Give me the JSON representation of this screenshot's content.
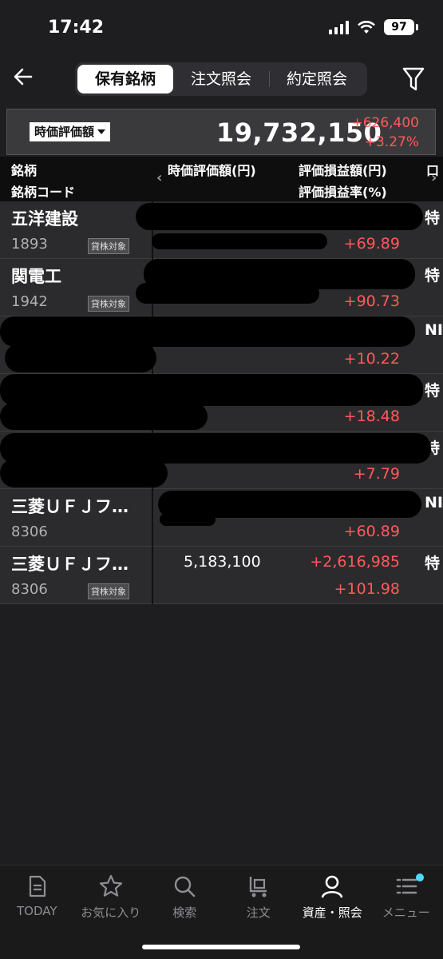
{
  "status": {
    "time": "17:42",
    "battery": "97"
  },
  "header": {
    "tabs": [
      {
        "label": "保有銘柄"
      },
      {
        "label": "注文照会"
      },
      {
        "label": "約定照会"
      }
    ]
  },
  "summary": {
    "dropdown": "時価評価額",
    "total": "19,732,150",
    "change": "+626,400",
    "change_pct": "+3.27%"
  },
  "table_header": {
    "col1a": "銘柄",
    "col1b": "銘柄コード",
    "col2": "時価評価額(円)",
    "col3a": "評価損益額(円)",
    "col3b": "評価損益率(%)",
    "col4": "口"
  },
  "holdings": [
    {
      "name": "五洋建設",
      "code": "1893",
      "tag": "貸株対象",
      "value": "",
      "pl": "",
      "rate": "+69.89",
      "account": "特"
    },
    {
      "name": "関電工",
      "code": "1942",
      "tag": "貸株対象",
      "value": "",
      "pl": "",
      "rate": "+90.73",
      "account": "特"
    },
    {
      "name": "",
      "code": "",
      "tag": "",
      "value": "",
      "pl": "",
      "rate": "+10.22",
      "account": "NI"
    },
    {
      "name": "",
      "code": "",
      "tag": "",
      "value": "",
      "pl": "",
      "rate": "+18.48",
      "account": "特"
    },
    {
      "name": "",
      "code": "",
      "tag": "",
      "value": "",
      "pl": "",
      "rate": "+7.79",
      "account": "特"
    },
    {
      "name": "三菱ＵＦＪフ…",
      "code": "8306",
      "tag": "",
      "value": "",
      "pl": "",
      "rate": "+60.89",
      "account": "NI"
    },
    {
      "name": "三菱ＵＦＪフ…",
      "code": "8306",
      "tag": "貸株対象",
      "value": "5,183,100",
      "pl": "+2,616,985",
      "rate": "+101.98",
      "account": "特"
    }
  ],
  "nav": [
    {
      "label": "TODAY",
      "icon": "document-icon"
    },
    {
      "label": "お気に入り",
      "icon": "star-icon"
    },
    {
      "label": "検索",
      "icon": "search-icon"
    },
    {
      "label": "注文",
      "icon": "cart-icon"
    },
    {
      "label": "資産・照会",
      "icon": "person-icon"
    },
    {
      "label": "メニュー",
      "icon": "menu-list-icon"
    }
  ]
}
